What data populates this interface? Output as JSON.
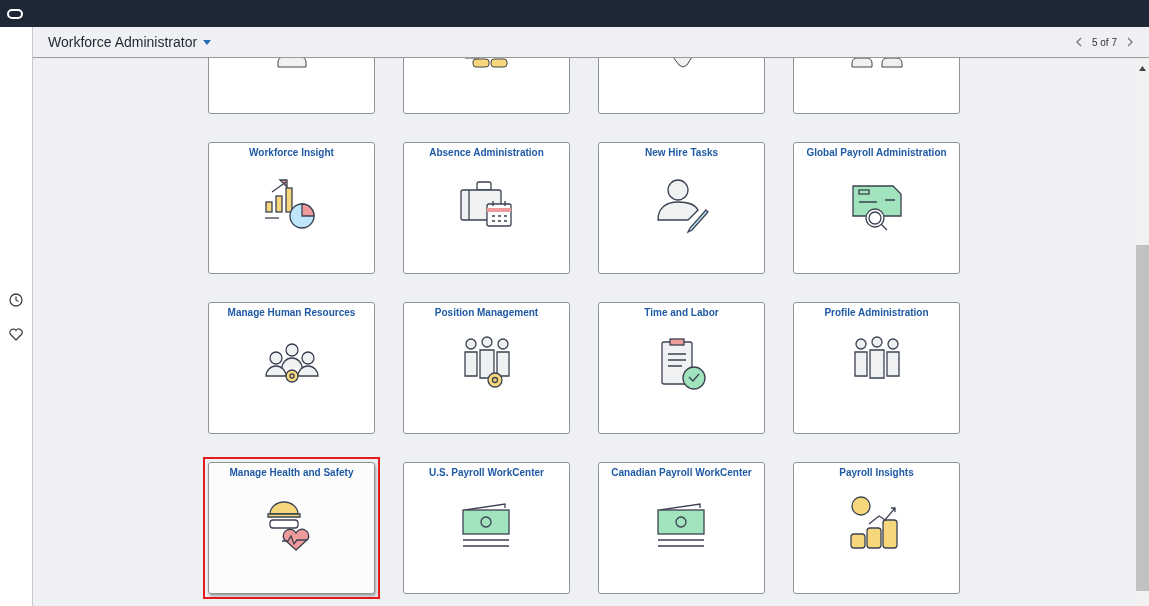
{
  "header": {
    "title": "Workforce Administrator",
    "pager": "5 of 7"
  },
  "tiles": [
    {
      "title": "Workforce Insight",
      "selected": false
    },
    {
      "title": "Absence Administration",
      "selected": false
    },
    {
      "title": "New Hire Tasks",
      "selected": false
    },
    {
      "title": "Global Payroll Administration",
      "selected": false
    },
    {
      "title": "Manage Human Resources",
      "selected": false
    },
    {
      "title": "Position Management",
      "selected": false
    },
    {
      "title": "Time and Labor",
      "selected": false
    },
    {
      "title": "Profile Administration",
      "selected": false
    },
    {
      "title": "Manage Health and Safety",
      "selected": true
    },
    {
      "title": "U.S. Payroll WorkCenter",
      "selected": false
    },
    {
      "title": "Canadian Payroll WorkCenter",
      "selected": false
    },
    {
      "title": "Payroll Insights",
      "selected": false
    }
  ]
}
